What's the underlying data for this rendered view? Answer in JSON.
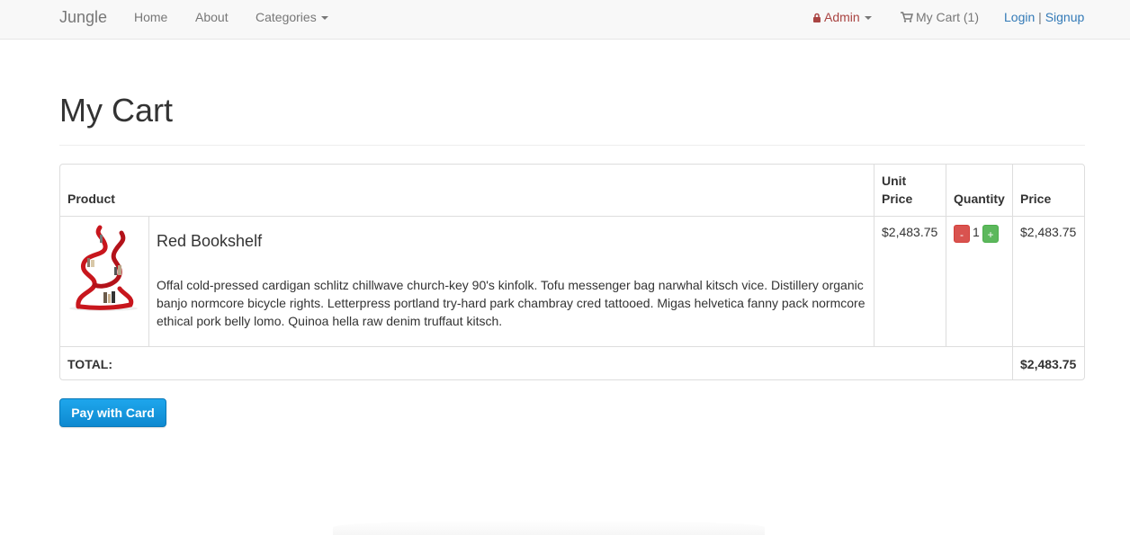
{
  "navbar": {
    "brand": "Jungle",
    "home": "Home",
    "about": "About",
    "categories": "Categories",
    "admin": "Admin",
    "cart": "My Cart (1)",
    "login": "Login",
    "separator": "|",
    "signup": "Signup"
  },
  "page": {
    "title": "My Cart"
  },
  "table": {
    "headers": {
      "product": "Product",
      "unit_price_line1": "Unit",
      "unit_price_line2": "Price",
      "quantity": "Quantity",
      "price": "Price"
    },
    "rows": [
      {
        "name": "Red Bookshelf",
        "description": "Offal cold-pressed cardigan schlitz chillwave church-key 90's kinfolk. Tofu messenger bag narwhal kitsch vice. Distillery organic banjo normcore bicycle rights. Letterpress portland try-hard park chambray cred tattooed. Migas helvetica fanny pack normcore ethical pork belly lomo. Quinoa hella raw denim truffaut kitsch.",
        "unit_price": "$2,483.75",
        "quantity": "1",
        "minus_label": "-",
        "plus_label": "+",
        "price": "$2,483.75"
      }
    ],
    "total_label": "TOTAL:",
    "total_value": "$2,483.75"
  },
  "actions": {
    "pay_button": "Pay with Card"
  },
  "colors": {
    "admin": "#a94442",
    "link": "#337ab7",
    "minus": "#d9534f",
    "plus": "#5cb85c",
    "pay_button": "#1a9bdf"
  }
}
